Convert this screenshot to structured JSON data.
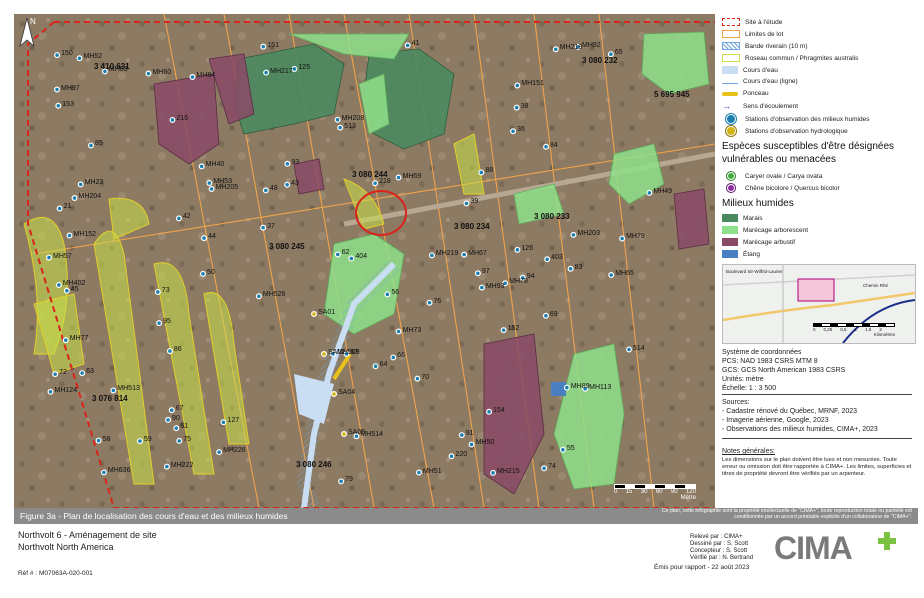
{
  "map": {
    "lot_numbers": [
      "3 410 631",
      "3 080 232",
      "5 695 945",
      "3 080 244",
      "3 080 245",
      "3 080 234",
      "3 080 233",
      "3 076 814",
      "3 080 246"
    ],
    "stations_wetland": [
      "MH636",
      "MH526",
      "MH23",
      "MH65",
      "MH513",
      "MH514",
      "MH509",
      "MH57",
      "MH77",
      "MH78",
      "MH82",
      "MH79",
      "MH69",
      "MH67",
      "MH93",
      "MH49",
      "MH51",
      "MH53",
      "MH52",
      "MH50",
      "MH60",
      "MH63",
      "MH73",
      "MH89",
      "MH84",
      "MH113",
      "MH152",
      "MH124",
      "MH151",
      "MH219",
      "MH97",
      "MH402",
      "MH204",
      "MH205",
      "MH203",
      "MH40",
      "MH215",
      "MH226",
      "MH222",
      "MH208",
      "MH217",
      "MH218"
    ],
    "stations_hydro": [
      "SA01",
      "SA02",
      "SA04",
      "SA05"
    ],
    "point_numbers": [
      "21",
      "65",
      "66",
      "61",
      "62",
      "63",
      "64",
      "59",
      "58",
      "56",
      "57",
      "70",
      "79",
      "69",
      "67",
      "93",
      "83",
      "76",
      "73",
      "48",
      "43",
      "44",
      "39",
      "45",
      "55",
      "50",
      "42",
      "38",
      "41",
      "37",
      "36",
      "74",
      "75",
      "72",
      "95",
      "97",
      "403",
      "404",
      "216",
      "220",
      "218",
      "85",
      "86",
      "84",
      "90",
      "88",
      "91",
      "94",
      "150",
      "151",
      "152",
      "153",
      "154",
      "125",
      "126",
      "127",
      "514",
      "513"
    ],
    "scale_ticks": [
      "0",
      "15",
      "30",
      "60",
      "90",
      "120"
    ],
    "scale_unit": "Mètre",
    "road_label": "Boulevard Sir-Wilfrid-Laurier"
  },
  "legend": {
    "items": [
      {
        "label": "Site à l'étude",
        "color": "#d9241c"
      },
      {
        "label": "Limites de lot",
        "color": "#f0a44a"
      },
      {
        "label": "Bande riverain (10 m)",
        "color": "#6fa6dc"
      },
      {
        "label": "Roseau commun / Phragmites australis",
        "color": "#c8e04a"
      },
      {
        "label": "Cours d'eau",
        "color": "#c9ddf3"
      },
      {
        "label": "Cours d'eau (ligne)",
        "color": "#6fa6dc"
      },
      {
        "label": "Ponceau",
        "color": "#e8c21a"
      },
      {
        "label": "Sens d'écoulement",
        "color": "#1f4fa6"
      },
      {
        "label": "Stations d'observation des milieux humides",
        "color": "#1c7fae"
      },
      {
        "label": "Stations d'observation hydrologique",
        "color": "#d4b20f"
      }
    ],
    "species_heading": "Espèces susceptibles d'être désignées vulnérables ou menacées",
    "species": [
      {
        "label": "Caryer ovale / Carya ovata",
        "color": "#3fae3a"
      },
      {
        "label": "Chêne bicolore / Quercus bicolor",
        "color": "#8f2fa4"
      }
    ],
    "wetland_heading": "Milieux humides",
    "wetlands": [
      {
        "label": "Marais",
        "color": "#4a8a5e"
      },
      {
        "label": "Marécage arborescent",
        "color": "#8fe08a"
      },
      {
        "label": "Marécage arbustif",
        "color": "#8a4a66"
      },
      {
        "label": "Étang",
        "color": "#4a7fc1"
      }
    ],
    "inset_labels": [
      "Boulevard Sir-Wilfrid-Laurier",
      "Chemin Rhé"
    ],
    "inset_scale": [
      "0",
      "0,25",
      "0,5",
      "1",
      "1,5",
      "2"
    ],
    "inset_unit": "Kilomètres",
    "coords": [
      "Système de coordonnées",
      "PCS: NAD 1983 CSRS MTM 8",
      "GCS: GCS North American 1983 CSRS",
      "Unités: mètre",
      "Échelle: 1 : 3 500"
    ],
    "sources_title": "Sources:",
    "sources": [
      "- Cadastre rénové du Québec, MRNF, 2023",
      "- Imagerie aérienne, Google, 2023",
      "- Observations des milieux humides, CIMA+, 2023"
    ],
    "notes_title": "Notes générales:",
    "notes_text": "Les dimensions sur le plan doivent être lues et non mesurées. Toute erreur ou omission doit être rapportée à CIMA+. Les limites, superficies et titres de propriété devront être vérifiés par un arpenteur."
  },
  "caption": {
    "title": "Figure 3a - Plan de localisation des cours d'eau et des milieux humides",
    "notice": "Ce plan, cette infographie sont la propriété intellectuelle de \"CIMA+\"; toute reproduction totale ou partielle est conditionnée par un accord préalable explicite d'un collaborateur de \"CIMA+\"."
  },
  "titleblock": {
    "project_fr": "Northvolt 6 - Aménagement de site",
    "project_en": "Northvolt North America",
    "reference": "Réf # : M07063A-020-001",
    "people": [
      "Relevé par : CIMA+",
      "Dessiné par : S. Scott",
      "Concepteur : S. Scott",
      "Vérifié par : N. Bertrand"
    ],
    "issued": "Émis pour rapport - 22 août 2023",
    "logo": "CIMA+",
    "logo_color": "#7a7a7a",
    "logo_accent": "#7cc242"
  },
  "colors": {
    "site_border": "#d9241c",
    "marais": "#4a8a5e",
    "marecage_arborescent": "#8fe08a",
    "marecage_arbustif": "#8a4a66",
    "etang": "#4a7fc1",
    "roseau": "#c8e04a",
    "cours_eau": "#c9ddf3"
  }
}
